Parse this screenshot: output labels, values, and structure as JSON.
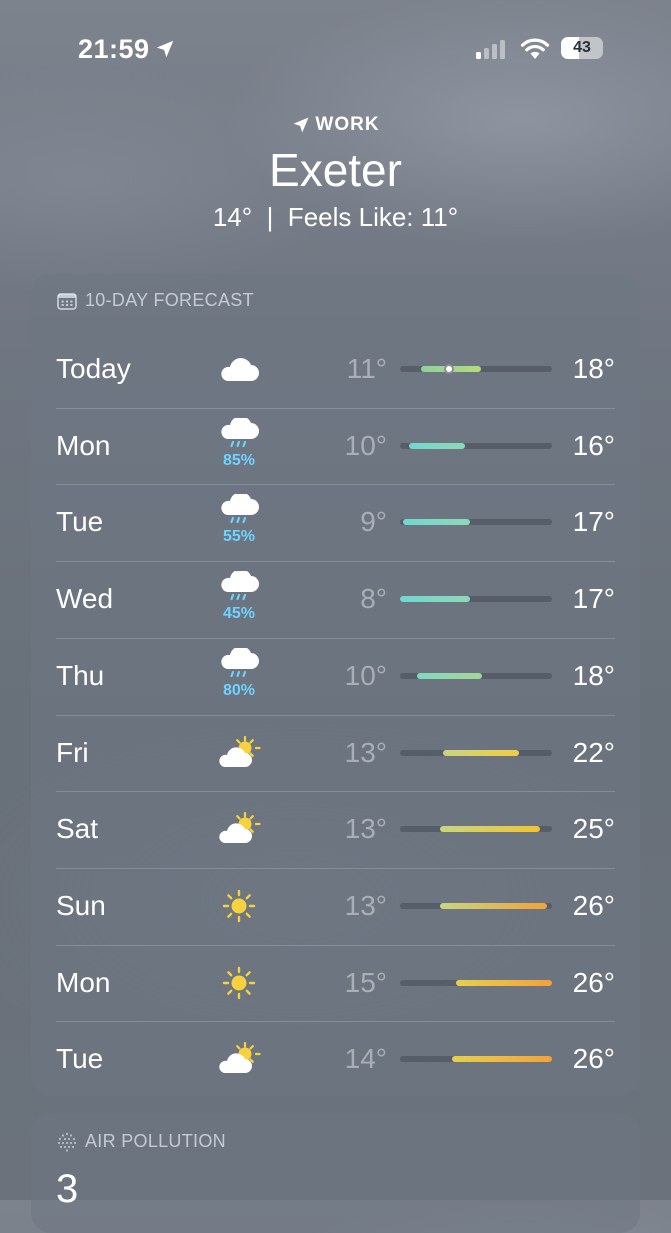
{
  "status_bar": {
    "time": "21:59",
    "battery": "43",
    "icons": [
      "location-arrow-icon",
      "cellular-signal-icon",
      "wifi-icon",
      "battery-icon"
    ]
  },
  "header": {
    "location_label": "WORK",
    "city": "Exeter",
    "current": "14°  |  Feels Like: 11°"
  },
  "forecast": {
    "title": "10-DAY FORECAST",
    "icon": "calendar-icon",
    "days": [
      {
        "day": "Today",
        "icon": "cloud-icon",
        "precip": "",
        "low": "11°",
        "high": "18°",
        "bar_start": 0.14,
        "bar_end": 0.53,
        "current_pos": 0.32,
        "bar_colors": [
          "#8fd19a",
          "#b4dc7c"
        ]
      },
      {
        "day": "Mon",
        "icon": "rain-cloud-icon",
        "precip": "85%",
        "low": "10°",
        "high": "16°",
        "bar_start": 0.06,
        "bar_end": 0.43,
        "bar_colors": [
          "#6fd8cf",
          "#8fd8b8"
        ]
      },
      {
        "day": "Tue",
        "icon": "rain-cloud-icon",
        "precip": "55%",
        "low": "9°",
        "high": "17°",
        "bar_start": 0.02,
        "bar_end": 0.46,
        "bar_colors": [
          "#6fd8cf",
          "#8fd8b8"
        ]
      },
      {
        "day": "Wed",
        "icon": "rain-cloud-icon",
        "precip": "45%",
        "low": "8°",
        "high": "17°",
        "bar_start": 0.0,
        "bar_end": 0.46,
        "bar_colors": [
          "#6fd8cf",
          "#8fd8b8"
        ]
      },
      {
        "day": "Thu",
        "icon": "rain-cloud-icon",
        "precip": "80%",
        "low": "10°",
        "high": "18°",
        "bar_start": 0.11,
        "bar_end": 0.54,
        "bar_colors": [
          "#7fd9c0",
          "#a8d69a"
        ]
      },
      {
        "day": "Fri",
        "icon": "partly-sunny-icon",
        "precip": "",
        "low": "13°",
        "high": "22°",
        "bar_start": 0.28,
        "bar_end": 0.78,
        "bar_colors": [
          "#c8d580",
          "#f3cc42"
        ]
      },
      {
        "day": "Sat",
        "icon": "partly-sunny-icon",
        "precip": "",
        "low": "13°",
        "high": "25°",
        "bar_start": 0.26,
        "bar_end": 0.92,
        "bar_colors": [
          "#c8d580",
          "#f3c430"
        ]
      },
      {
        "day": "Sun",
        "icon": "sun-icon",
        "precip": "",
        "low": "13°",
        "high": "26°",
        "bar_start": 0.26,
        "bar_end": 0.97,
        "bar_colors": [
          "#c8d580",
          "#f2a23a"
        ]
      },
      {
        "day": "Mon",
        "icon": "sun-icon",
        "precip": "",
        "low": "15°",
        "high": "26°",
        "bar_start": 0.37,
        "bar_end": 1.0,
        "bar_colors": [
          "#e6cf4f",
          "#f2a23a"
        ]
      },
      {
        "day": "Tue",
        "icon": "partly-sunny-icon",
        "precip": "",
        "low": "14°",
        "high": "26°",
        "bar_start": 0.34,
        "bar_end": 1.0,
        "bar_colors": [
          "#e6cf4f",
          "#f2a23a"
        ]
      }
    ]
  },
  "air_pollution": {
    "title": "AIR POLLUTION",
    "icon": "air-quality-icon",
    "value": "3"
  }
}
